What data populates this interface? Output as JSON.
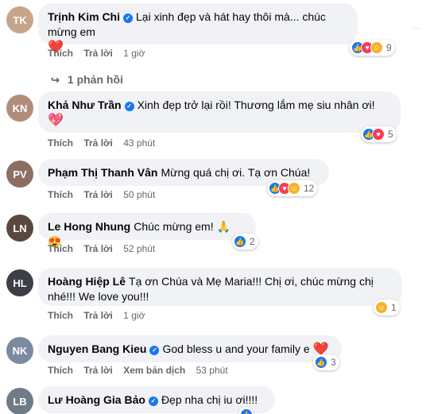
{
  "colors": {
    "accent": "#1877f2",
    "bubble": "#f0f2f5",
    "meta": "#65676b",
    "love": "#f33e58"
  },
  "more_icon": "···",
  "comments": [
    {
      "author": "Trịnh Kim Chi",
      "text": "Lại xinh đẹp và hát hay thôi mà... chúc mừng em",
      "text2": "❤️",
      "like": "Thích",
      "reply": "Trả lời",
      "time": "1 giờ",
      "react_count": "9",
      "avatar_color": "#c7a58a"
    },
    {
      "author": "Khả Như Trần",
      "text": "Xinh đẹp trở lại rồi! Thương lắm mẹ siu nhân ơi!",
      "text2": "💖",
      "like": "Thích",
      "reply": "Trả lời",
      "time": "43 phút",
      "react_count": "5",
      "avatar_color": "#b08d7a"
    },
    {
      "author": "Phạm Thị Thanh Vân",
      "text": "Mừng quá chị ơi. Tạ ơn Chúa!",
      "like": "Thích",
      "reply": "Trả lời",
      "time": "50 phút",
      "react_count": "12",
      "avatar_color": "#8b6f62"
    },
    {
      "author": "Le Hong Nhung",
      "text": "Chúc mừng em!",
      "text2": "🙏 😍",
      "like": "Thích",
      "reply": "Trả lời",
      "time": "52 phút",
      "react_count": "2",
      "avatar_color": "#5a4740"
    },
    {
      "author": "Hoàng Hiệp Lê",
      "text": "Tạ ơn Chúa và Mẹ Maria!!! Chị ơi, chúc mừng chị",
      "text2": "nhé!!! We love you!!!",
      "like": "Thích",
      "reply": "Trả lời",
      "time": "1 giờ",
      "react_count": "1",
      "avatar_color": "#3c3f47"
    },
    {
      "author": "Nguyen Bang Kieu",
      "text": "God bless u and your family e",
      "text2": "❤️",
      "like": "Thích",
      "reply": "Trả lời",
      "translate": "Xem bản dịch",
      "time": "53 phút",
      "react_count": "3",
      "avatar_color": "#7c8aa0"
    },
    {
      "author": "Lư Hoàng Gia Bảo",
      "text": "Đẹp nha chị iu ơi!!!!",
      "avatar_color": "#6f7c88"
    }
  ],
  "reply_thread": {
    "label": "1 phản hồi"
  }
}
